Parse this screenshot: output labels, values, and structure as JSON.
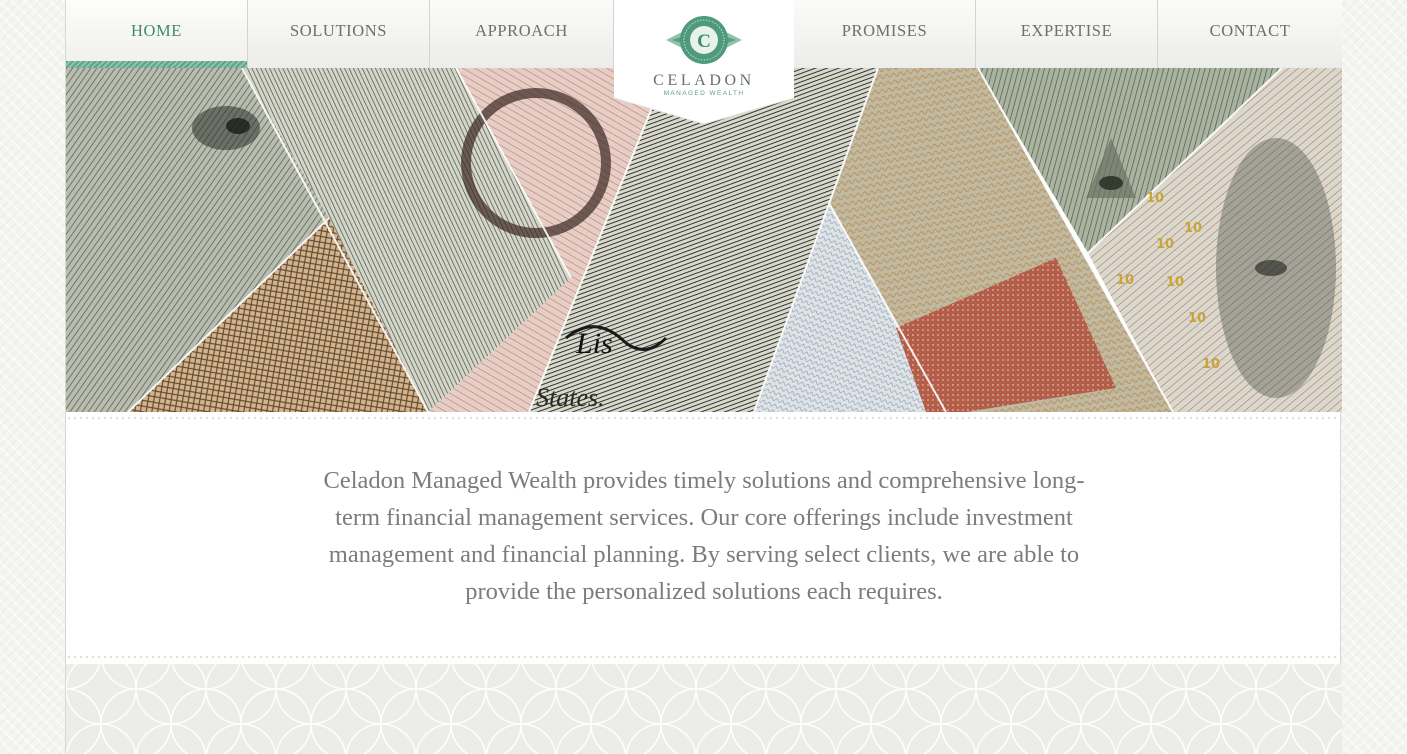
{
  "nav": {
    "left": [
      {
        "label": "HOME",
        "active": true
      },
      {
        "label": "SOLUTIONS",
        "active": false
      },
      {
        "label": "APPROACH",
        "active": false
      }
    ],
    "right": [
      {
        "label": "PROMISES",
        "active": false
      },
      {
        "label": "EXPERTISE",
        "active": false
      },
      {
        "label": "CONTACT",
        "active": false
      }
    ]
  },
  "logo": {
    "initial": "C",
    "name": "CELADON",
    "tagline": "MANAGED WEALTH"
  },
  "hero": {
    "banknote_text": "States.",
    "signature": "Lis",
    "numerals": [
      "10",
      "10",
      "10",
      "10",
      "10",
      "10",
      "10"
    ]
  },
  "intro": {
    "text": "Celadon Managed Wealth provides timely solutions and comprehensive long-term financial management services. Our core offerings include investment management and financial planning. By serving select clients, we are able to provide the personalized solutions each requires."
  },
  "colors": {
    "accent": "#3f8b6e",
    "accent_light": "#8cc2ae",
    "text": "#7a7d79",
    "nav_text": "#6e706c"
  }
}
